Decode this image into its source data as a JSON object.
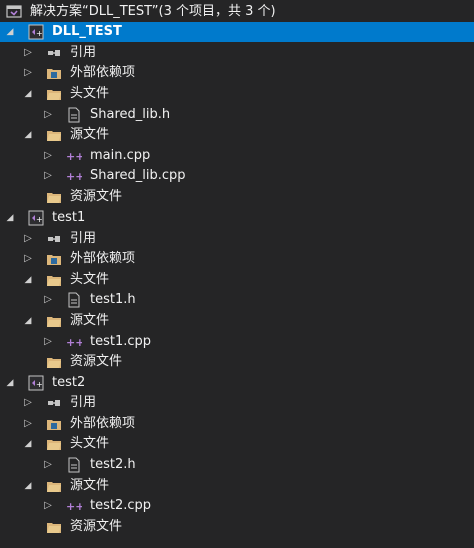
{
  "solution": {
    "label": "解决方案“DLL_TEST”(3 个项目，共 3 个)"
  },
  "projects": [
    {
      "name": "DLL_TEST",
      "references": "引用",
      "external_deps": "外部依赖项",
      "header_files": "头文件",
      "header_items": [
        "Shared_lib.h"
      ],
      "source_files": "源文件",
      "source_items": [
        "main.cpp",
        "Shared_lib.cpp"
      ],
      "resource_files": "资源文件"
    },
    {
      "name": "test1",
      "references": "引用",
      "external_deps": "外部依赖项",
      "header_files": "头文件",
      "header_items": [
        "test1.h"
      ],
      "source_files": "源文件",
      "source_items": [
        "test1.cpp"
      ],
      "resource_files": "资源文件"
    },
    {
      "name": "test2",
      "references": "引用",
      "external_deps": "外部依赖项",
      "header_files": "头文件",
      "header_items": [
        "test2.h"
      ],
      "source_files": "源文件",
      "source_items": [
        "test2.cpp"
      ],
      "resource_files": "资源文件"
    }
  ],
  "colors": {
    "background": "#252526",
    "selection": "#007acc",
    "text": "#f1f1f1",
    "folder": "#dcb67a",
    "project": "#b180d7"
  },
  "icons": {
    "solution": "solution-icon",
    "project": "cpp-project-icon",
    "references": "references-icon",
    "external_deps": "external-dependencies-icon",
    "filter_folder": "filter-folder-icon",
    "header_file": "header-file-icon",
    "source_file": "cpp-source-icon"
  }
}
